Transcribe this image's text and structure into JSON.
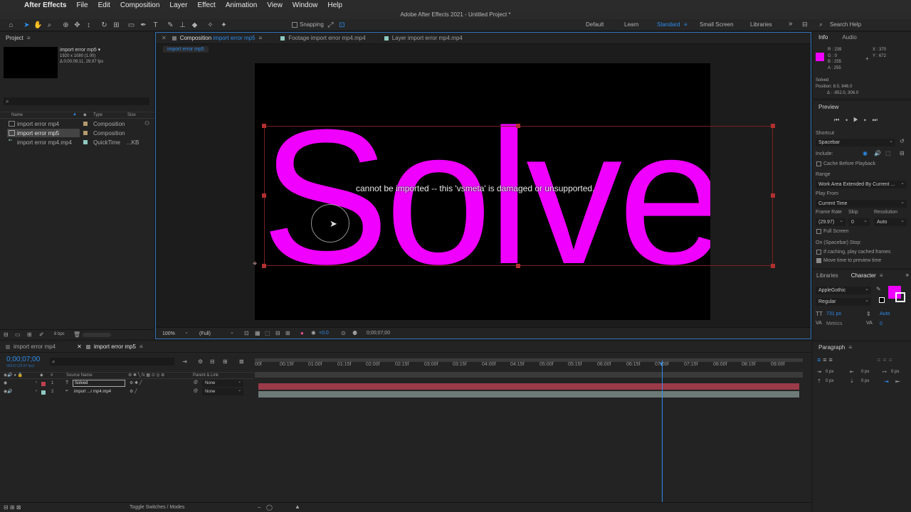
{
  "menubar": {
    "app": "After Effects",
    "items": [
      "File",
      "Edit",
      "Composition",
      "Layer",
      "Effect",
      "Animation",
      "View",
      "Window",
      "Help"
    ]
  },
  "title": "Adobe After Effects 2021 - Untitled Project *",
  "toolbar": {
    "snapping_label": "Snapping",
    "workspaces": [
      "Default",
      "Learn",
      "Standard",
      "Small Screen",
      "Libraries"
    ],
    "active_workspace": "Standard",
    "search_placeholder": "Search Help"
  },
  "project": {
    "title": "Project",
    "selected_name": "import error mp5 ▾",
    "selected_info1": "1920 x 1080 (1.00)",
    "selected_info2": "Δ 0;00;09;11, 29.97 fps",
    "columns": {
      "name": "Name",
      "type": "Type",
      "size": "Size"
    },
    "items": [
      {
        "name": "import error mp4",
        "type": "Composition",
        "size": "",
        "color": "#b49a6e"
      },
      {
        "name": "import error mp5",
        "type": "Composition",
        "size": "",
        "color": "#b49a6e"
      },
      {
        "name": "import error mp4.mp4",
        "type": "QuickTime",
        "size": "...KB",
        "color": "#8fc9c0"
      }
    ],
    "bpc": "8 bpc"
  },
  "viewer": {
    "tabs": [
      {
        "label": "Composition",
        "name": "import error mp5"
      },
      {
        "label": "Footage import error mp4.mp4"
      },
      {
        "label": "Layer import error mp4.mp4"
      }
    ],
    "breadcrumb": "import error mp5",
    "big_text": "Solved",
    "error_text": "cannot be imported -- this 'vsmeta' is damaged or unsupported.",
    "zoom": "100%",
    "resolution": "(Full)",
    "exposure": "+0.0",
    "timecode": "0;00;07;00",
    "text_color": "#ef00ff"
  },
  "info": {
    "tabs": [
      "Info",
      "Audio"
    ],
    "r": "R : 239",
    "g": "G : 0",
    "b": "B : 255",
    "a": "A : 255",
    "x": "X : 370",
    "y": "Y : 672",
    "layer": "Solved",
    "position": "Position: 8.0, 846.0",
    "delta": "Δ : -952.0, 306.0",
    "swatch": "#ef00ff"
  },
  "preview": {
    "title": "Preview",
    "shortcut_label": "Shortcut",
    "shortcut_value": "Spacebar",
    "include_label": "Include:",
    "cache_label": "Cache Before Playback",
    "range_label": "Range",
    "range_value": "Work Area Extended By Current ...",
    "playfrom_label": "Play From",
    "playfrom_value": "Current Time",
    "framerate_label": "Frame Rate",
    "skip_label": "Skip",
    "res_label": "Resolution",
    "framerate_value": "(29.97)",
    "skip_value": "0",
    "res_value": "Auto",
    "fullscreen_label": "Full Screen",
    "stop_label": "On (Spacebar) Stop:",
    "ifcache_label": "If caching, play cached frames",
    "movetime_label": "Move time to preview time"
  },
  "character": {
    "tabs": [
      "Libraries",
      "Character"
    ],
    "font": "AppleGothic",
    "style": "Regular",
    "size": "731 px",
    "leading": "Auto",
    "kerning": "Metrics",
    "tracking": "0",
    "fill": "#ef00ff"
  },
  "paragraph": {
    "title": "Paragraph",
    "vals": [
      "0 px",
      "0 px",
      "0 px",
      "0 px",
      "0 px"
    ]
  },
  "timeline": {
    "tabs": [
      "import error mp4",
      "import error mp5"
    ],
    "timecode": "0;00;07;00",
    "sub_timecode": "00210 (29.97 fps)",
    "col_source": "Source Name",
    "col_parent": "Parent & Link",
    "ruler": [
      "00f",
      "00:15f",
      "01:00f",
      "01:15f",
      "02:00f",
      "02:15f",
      "03:00f",
      "03:15f",
      "04:00f",
      "04:15f",
      "05:00f",
      "05:15f",
      "06:00f",
      "06:15f",
      "07:00f",
      "07:15f",
      "08:00f",
      "08:15f",
      "09:00f"
    ],
    "layers": [
      {
        "num": "1",
        "type": "T",
        "name": "Solved",
        "parent": "None",
        "color": "#c04050"
      },
      {
        "num": "2",
        "type": "",
        "name": "import ...r mp4.mp4",
        "parent": "None",
        "color": "#8fc9c0"
      }
    ],
    "toggle_label": "Toggle Switches / Modes"
  }
}
